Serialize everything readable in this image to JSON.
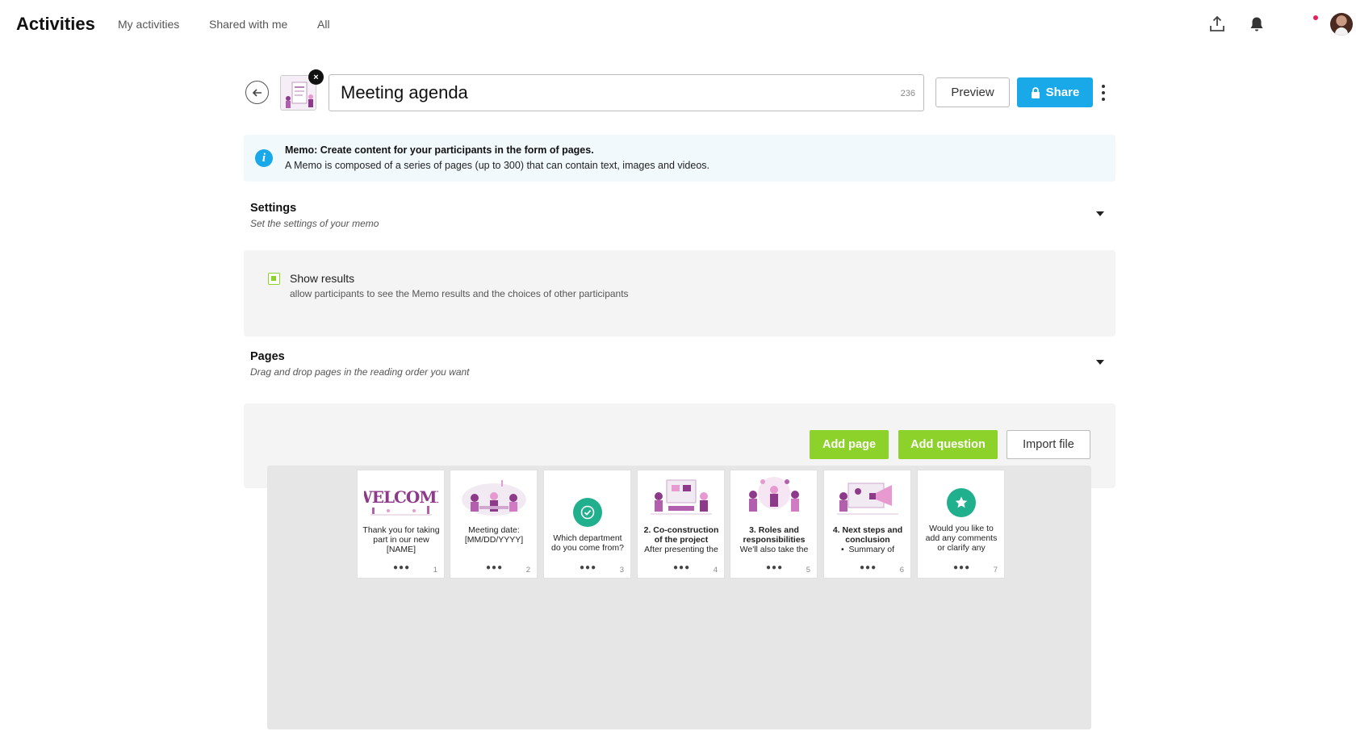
{
  "header": {
    "title": "Activities",
    "nav": [
      "My activities",
      "Shared with me",
      "All"
    ]
  },
  "toolbar": {
    "activity_title": "Meeting agenda",
    "char_count": "236",
    "preview_label": "Preview",
    "share_label": "Share"
  },
  "info": {
    "title": "Memo: Create content for your participants in the form of pages.",
    "text": "A Memo is composed of a series of pages (up to 300) that can contain text, images and videos."
  },
  "settings": {
    "title": "Settings",
    "subtitle": "Set the settings of your memo",
    "show_results": {
      "label": "Show results",
      "description": "allow participants to see the Memo results and the choices of other participants",
      "checked": true
    }
  },
  "pages": {
    "title": "Pages",
    "subtitle": "Drag and drop pages in the reading order you want",
    "add_page_label": "Add page",
    "add_question_label": "Add question",
    "import_label": "Import file",
    "cards": [
      {
        "number": "1",
        "text": "Thank you for taking part in our new [NAME]",
        "icon": "welcome-illustration"
      },
      {
        "number": "2",
        "text": "Meeting date: [MM/DD/YYYY]",
        "icon": "meeting-illustration"
      },
      {
        "number": "3",
        "text": "Which department do you come from?",
        "icon": "check-circle-icon"
      },
      {
        "number": "4",
        "title": "2. Co-construction of the project",
        "text": "After presenting the",
        "icon": "construction-illustration"
      },
      {
        "number": "5",
        "title": "3. Roles and responsibilities",
        "text": "We'll also take the",
        "icon": "team-illustration"
      },
      {
        "number": "6",
        "title": "4. Next steps and conclusion",
        "text": "Summary of",
        "icon": "megaphone-illustration"
      },
      {
        "number": "7",
        "text": "Would you like to add any comments or clarify any points?",
        "icon": "star-circle-icon"
      }
    ]
  },
  "colors": {
    "accent_blue": "#1aa9e8",
    "accent_green": "#8cd22a",
    "teal": "#21b08e",
    "illustration_purple": "#8e3a8a"
  }
}
